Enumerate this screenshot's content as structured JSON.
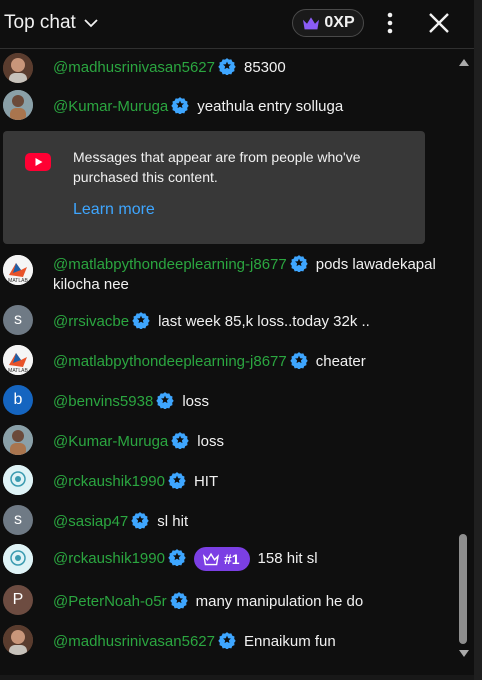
{
  "header": {
    "chat_mode": "Top chat",
    "xp_label": "0XP"
  },
  "notice": {
    "text": "Messages that appear are from people who've purchased this content.",
    "link": "Learn more"
  },
  "messages": [
    {
      "author": "@madhusrinivasan5627",
      "text": "85300"
    },
    {
      "author": "@Kumar-Muruga",
      "text": "yeathula entry solluga"
    },
    {
      "author": "@matlabpythondeeplearning-j8677",
      "text": "pods lawadekapal kilocha nee"
    },
    {
      "author": "@rrsivacbe",
      "text": "last week 85,k loss..today 32k .."
    },
    {
      "author": "@matlabpythondeeplearning-j8677",
      "text": "cheater"
    },
    {
      "author": "@benvins5938",
      "text": "loss"
    },
    {
      "author": "@Kumar-Muruga",
      "text": "loss"
    },
    {
      "author": "@rckaushik1990",
      "text": "HIT"
    },
    {
      "author": "@sasiap47",
      "text": "sl hit"
    },
    {
      "author": "@rckaushik1990",
      "text": "158 hit sl",
      "badge": "#1"
    },
    {
      "author": "@PeterNoah-o5r",
      "text": "many manipulation he do"
    },
    {
      "author": "@madhusrinivasan5627",
      "text": "Ennaikum fun"
    }
  ],
  "avatars": {
    "s": "s",
    "b": "b",
    "p": "P"
  },
  "colors": {
    "author": "#2ba640",
    "link": "#3ea6ff",
    "badge": "#7b3fe4",
    "verified": "#3ea6ff"
  }
}
